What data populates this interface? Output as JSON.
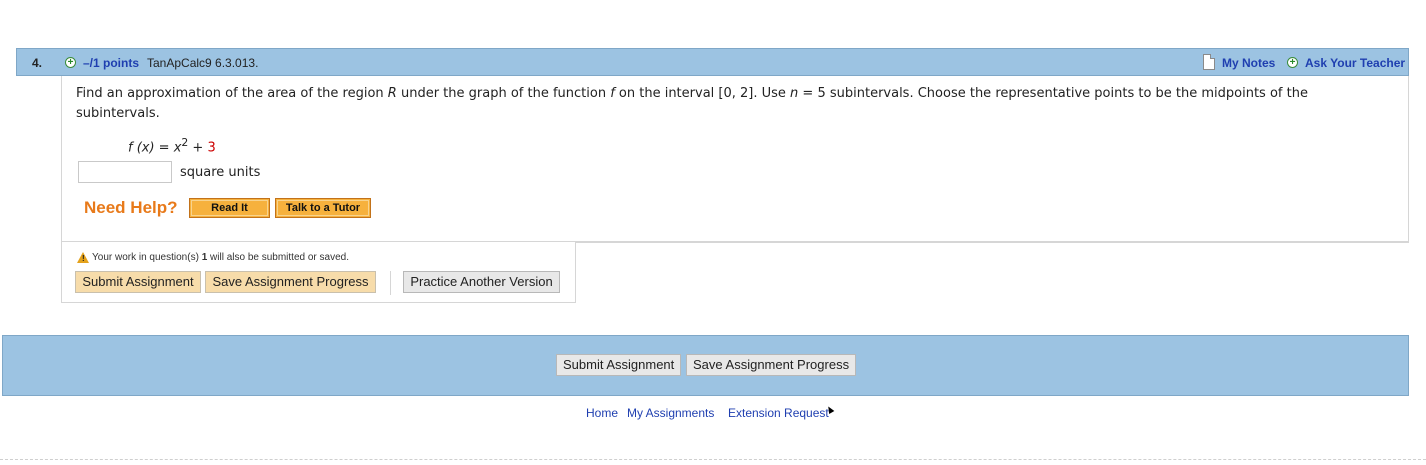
{
  "question": {
    "number": "4.",
    "points": "–/1 points",
    "id": "TanApCalc9 6.3.013.",
    "my_notes": "My Notes",
    "ask_teacher": "Ask Your Teacher",
    "text": "Find an approximation of the area of the region R under the graph of the function f on the interval [0, 2]. Use n = 5 subintervals. Choose the representative points to be the midpoints of the subintervals.",
    "formula_lhs": "f (x) = x",
    "formula_exp": "2",
    "formula_plus": " + ",
    "formula_const": "3",
    "answer_value": "",
    "units": "square units"
  },
  "help": {
    "label": "Need Help?",
    "read_it": "Read It",
    "talk_tutor": "Talk to a Tutor"
  },
  "submission": {
    "warning_prefix": "Your work in question(s) ",
    "warning_num": "1",
    "warning_suffix": " will also be submitted or saved.",
    "submit": "Submit Assignment",
    "save": "Save Assignment Progress",
    "practice": "Practice Another Version"
  },
  "bottom": {
    "submit": "Submit Assignment",
    "save": "Save Assignment Progress"
  },
  "footer": {
    "home": "Home",
    "my_assignments": "My Assignments",
    "extension": "Extension Request"
  },
  "colors": {
    "bar_blue": "#9cc3e2",
    "link_blue": "#1f3fb0",
    "help_orange": "#e87a1a",
    "button_tan": "#f7dcaa",
    "constant_red": "#cc0000"
  },
  "icons": [
    "plus-icon",
    "notes-icon",
    "warning-icon"
  ]
}
